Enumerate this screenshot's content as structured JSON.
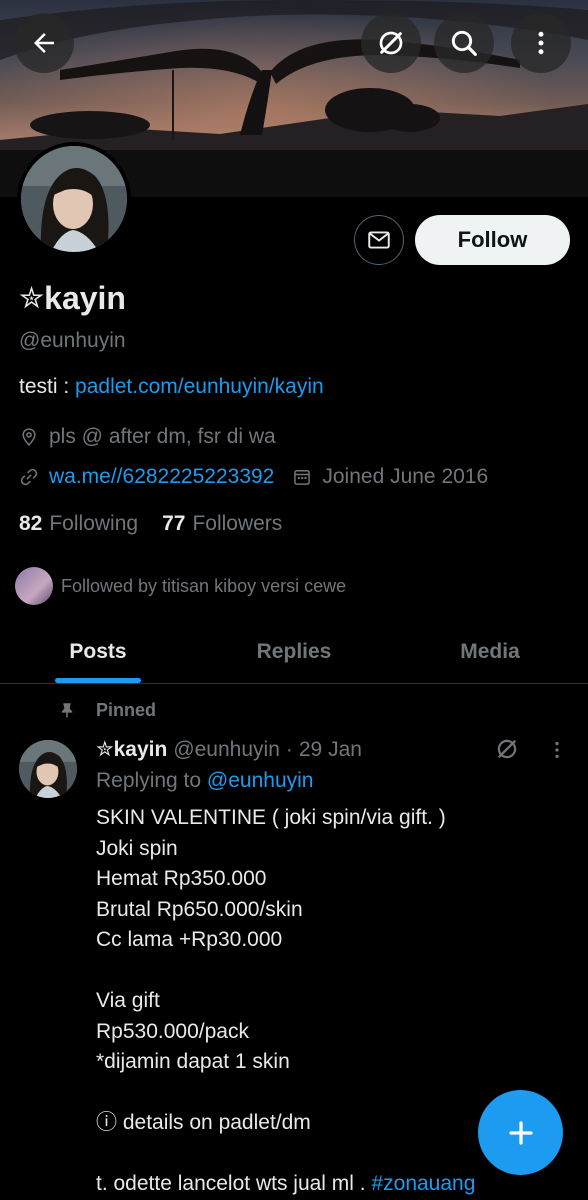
{
  "header": {
    "back_icon": "arrow-left-icon",
    "grok_icon": "grok-icon",
    "search_icon": "search-icon",
    "more_icon": "more-vertical-icon"
  },
  "profile": {
    "name_star": "✮",
    "name": "kayin",
    "handle": "@eunhuyin",
    "follow_label": "Follow",
    "bio_prefix": "testi : ",
    "bio_link": "padlet.com/eunhuyin/kayin",
    "location": "pls @ after dm, fsr di wa",
    "website": "wa.me//6282225223392",
    "joined": "Joined June 2016",
    "following_count": "82",
    "following_label": "Following",
    "followers_count": "77",
    "followers_label": "Followers",
    "followed_by": "Followed by titisan kiboy versi cewe"
  },
  "tabs": [
    {
      "label": "Posts",
      "active": true
    },
    {
      "label": "Replies",
      "active": false
    },
    {
      "label": "Media",
      "active": false
    }
  ],
  "pinned_post": {
    "pinned_label": "Pinned",
    "name_star": "✮",
    "name": "kayin",
    "handle": "@eunhuyin",
    "separator": "·",
    "date": "29 Jan",
    "replying_prefix": "Replying to ",
    "replying_handle": "@eunhuyin",
    "lines": [
      "SKIN VALENTINE ( joki spin/via gift. )",
      "Joki spin",
      "Hemat Rp350.000",
      "Brutal Rp650.000/skin",
      "Cc lama +Rp30.000",
      "",
      "Via gift",
      "Rp530.000/pack",
      "*dijamin dapat 1 skin",
      "",
      "ⓘ details on padlet/dm",
      ""
    ],
    "last_line_text": "t. odette lancelot wts jual ml . ",
    "last_line_hashtag": "#zonauang"
  },
  "colors": {
    "accent": "#1d9bf0",
    "muted": "#71767b",
    "text": "#e7e9ea",
    "background": "#000000"
  }
}
